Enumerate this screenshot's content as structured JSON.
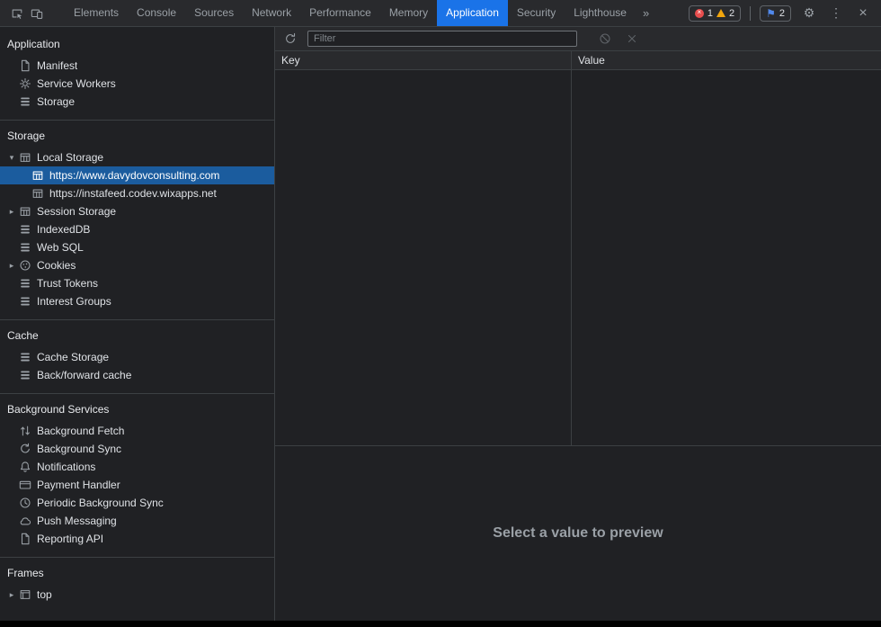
{
  "colors": {
    "accent_blue": "#1a73e8",
    "selection_blue": "#1b5c9e",
    "error_red": "#e84e4e",
    "warning_yellow": "#f2a60d",
    "issue_blue": "#5189ec"
  },
  "tabbar": {
    "tabs": [
      {
        "label": "Elements"
      },
      {
        "label": "Console"
      },
      {
        "label": "Sources"
      },
      {
        "label": "Network"
      },
      {
        "label": "Performance"
      },
      {
        "label": "Memory"
      },
      {
        "label": "Application",
        "active": true
      },
      {
        "label": "Security"
      },
      {
        "label": "Lighthouse"
      }
    ],
    "more_tabs_label": "»",
    "badges": {
      "errors": "1",
      "warnings": "2",
      "issues": "2"
    },
    "icons": {
      "gear": "⚙",
      "kebab": "⋮",
      "close": "×",
      "flag": "⚑"
    }
  },
  "sidebar": {
    "icons": {
      "arrow_down": "▾",
      "arrow_right": "▸"
    },
    "sections": [
      {
        "title": "Application",
        "items": [
          {
            "label": "Manifest",
            "icon": "doc"
          },
          {
            "label": "Service Workers",
            "icon": "gear"
          },
          {
            "label": "Storage",
            "icon": "stack"
          }
        ]
      },
      {
        "title": "Storage",
        "items": [
          {
            "label": "Local Storage",
            "icon": "grid",
            "arrow": "down"
          },
          {
            "label": "https://www.davydovconsulting.com",
            "icon": "grid",
            "depth": 1,
            "selected": true
          },
          {
            "label": "https://instafeed.codev.wixapps.net",
            "icon": "grid",
            "depth": 1
          },
          {
            "label": "Session Storage",
            "icon": "grid",
            "arrow": "right"
          },
          {
            "label": "IndexedDB",
            "icon": "stack"
          },
          {
            "label": "Web SQL",
            "icon": "stack"
          },
          {
            "label": "Cookies",
            "icon": "cookie",
            "arrow": "right"
          },
          {
            "label": "Trust Tokens",
            "icon": "stack"
          },
          {
            "label": "Interest Groups",
            "icon": "stack"
          }
        ]
      },
      {
        "title": "Cache",
        "items": [
          {
            "label": "Cache Storage",
            "icon": "stack"
          },
          {
            "label": "Back/forward cache",
            "icon": "stack"
          }
        ]
      },
      {
        "title": "Background Services",
        "items": [
          {
            "label": "Background Fetch",
            "icon": "updown"
          },
          {
            "label": "Background Sync",
            "icon": "sync"
          },
          {
            "label": "Notifications",
            "icon": "bell"
          },
          {
            "label": "Payment Handler",
            "icon": "card"
          },
          {
            "label": "Periodic Background Sync",
            "icon": "clock"
          },
          {
            "label": "Push Messaging",
            "icon": "cloud"
          },
          {
            "label": "Reporting API",
            "icon": "doc"
          }
        ]
      },
      {
        "title": "Frames",
        "items": [
          {
            "label": "top",
            "icon": "frame",
            "arrow": "right"
          }
        ]
      }
    ]
  },
  "main": {
    "filter": {
      "placeholder": "Filter",
      "value": ""
    },
    "table": {
      "columns": [
        "Key",
        "Value"
      ],
      "rows": []
    },
    "preview": {
      "message": "Select a value to preview"
    }
  }
}
